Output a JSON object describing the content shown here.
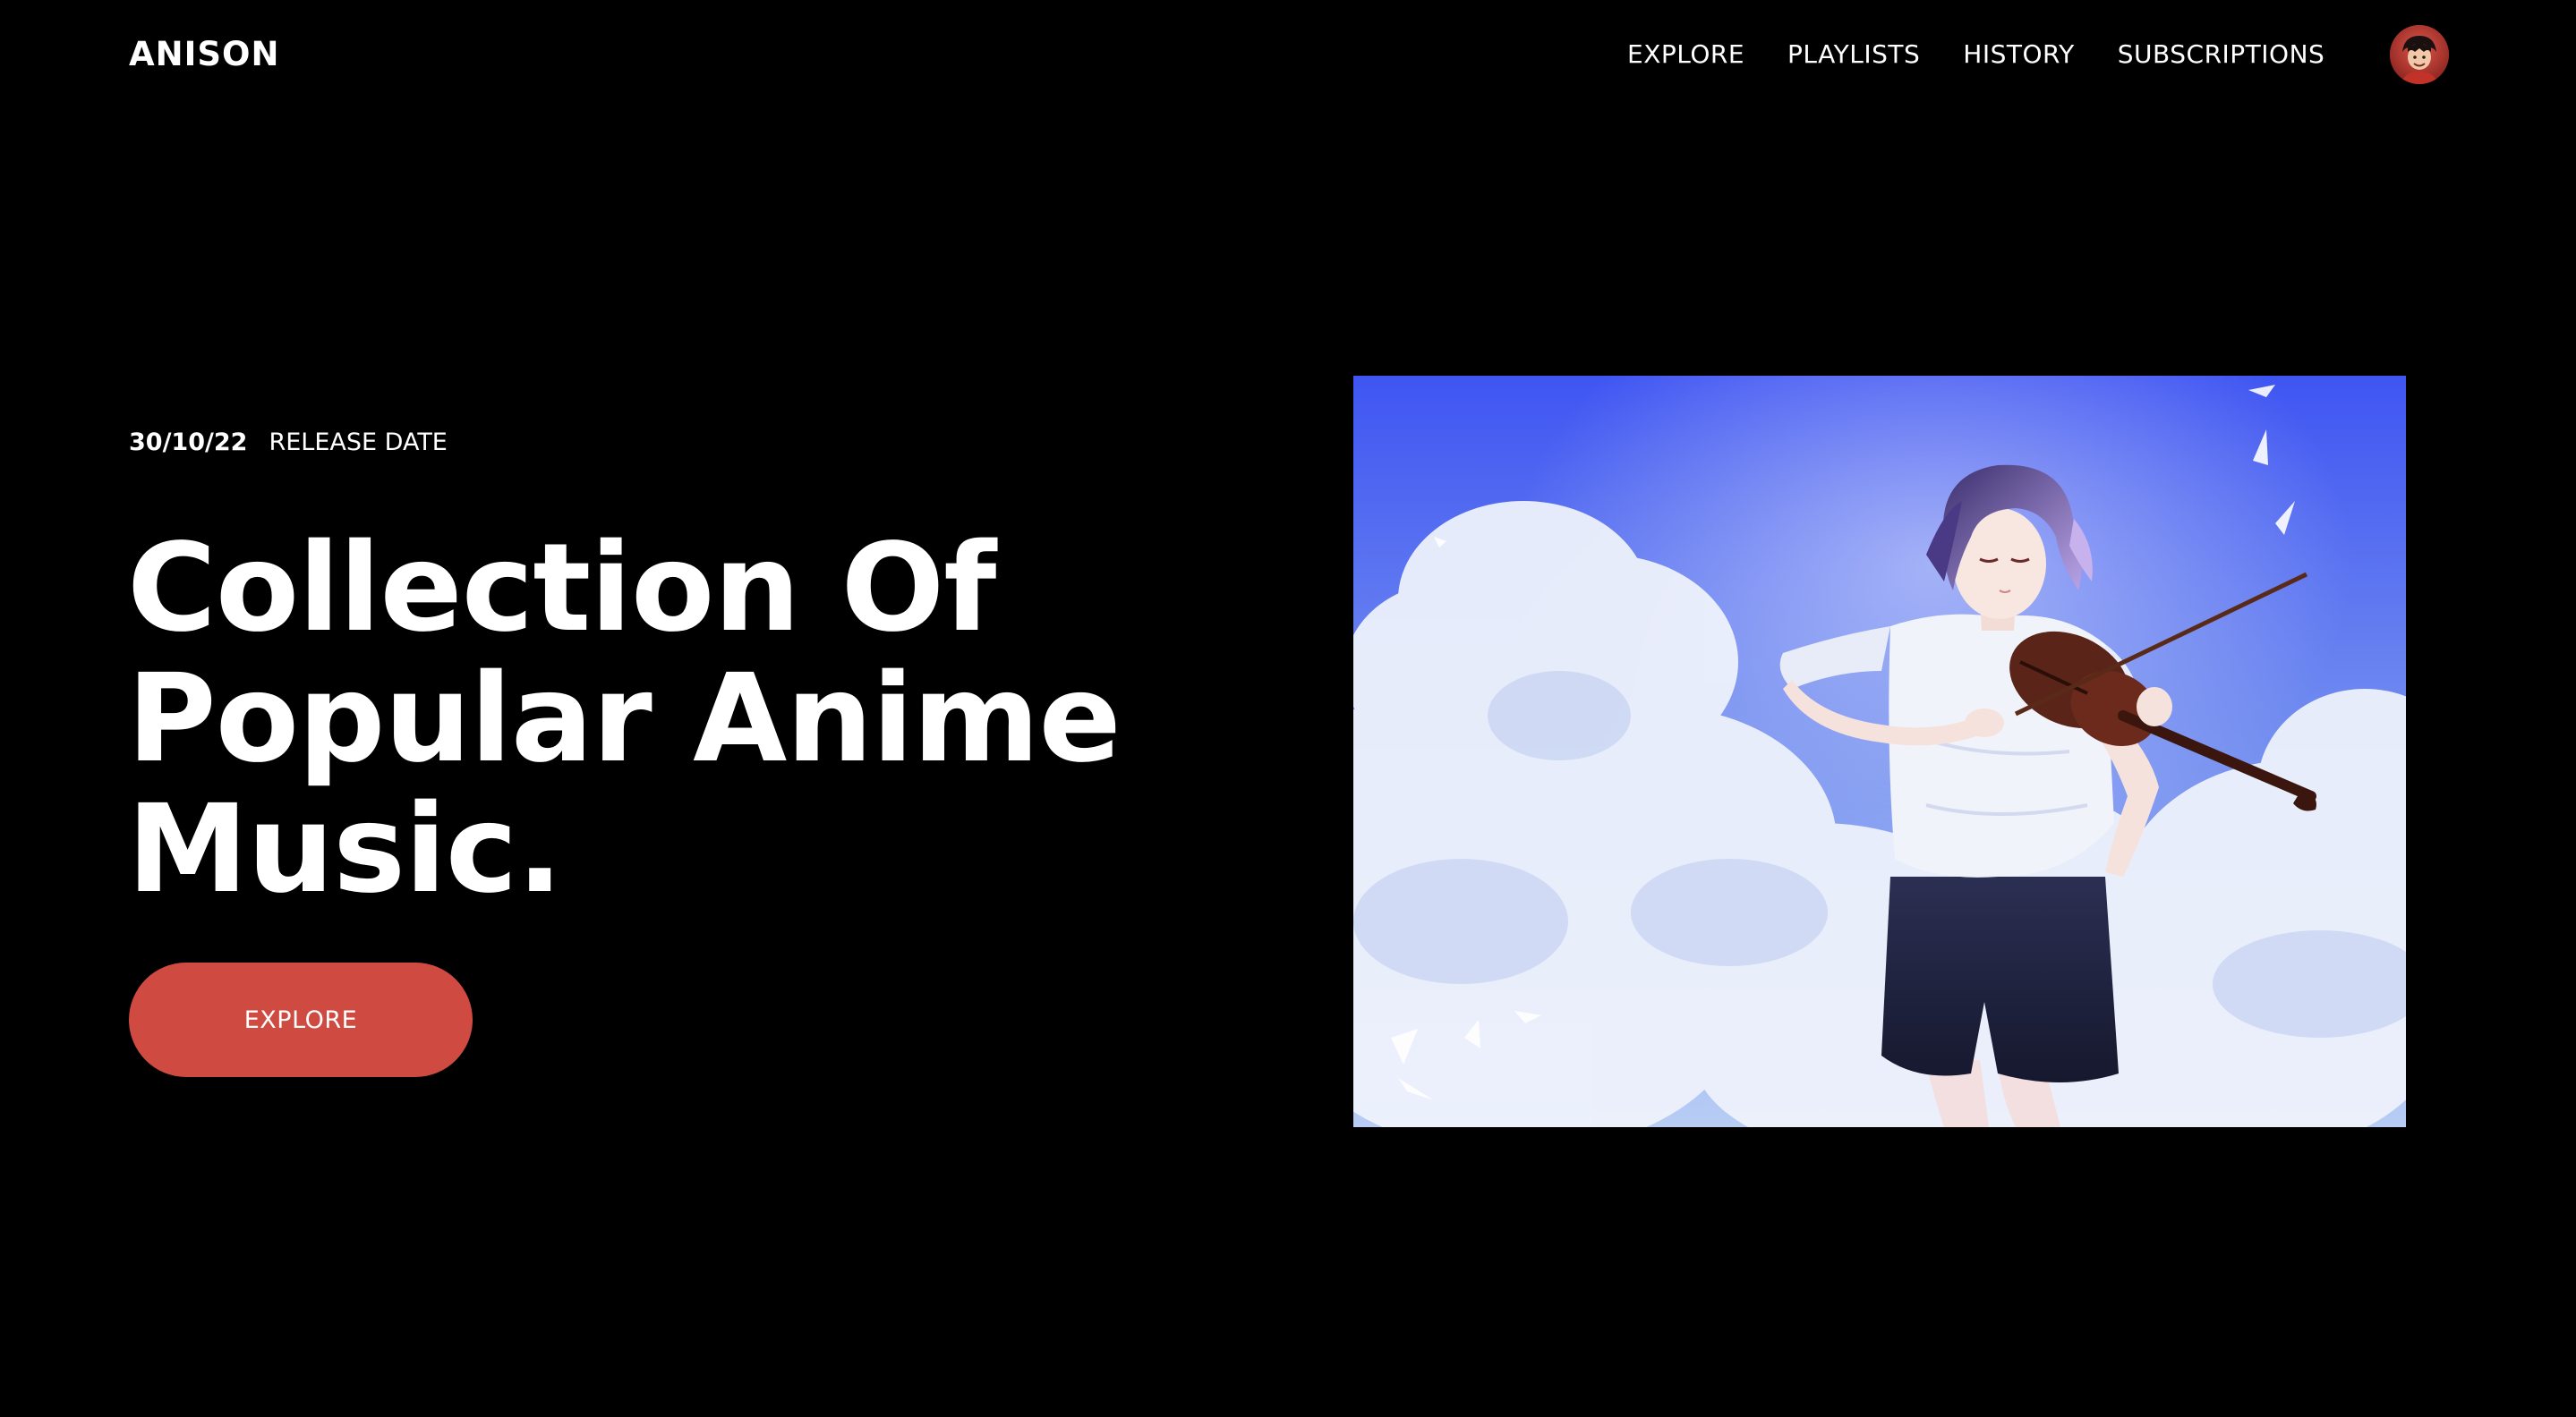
{
  "header": {
    "logo": "ANISON",
    "nav": [
      {
        "label": "EXPLORE"
      },
      {
        "label": "PLAYLISTS"
      },
      {
        "label": "HISTORY"
      },
      {
        "label": "SUBSCRIPTIONS"
      }
    ],
    "avatar_icon": "user-avatar"
  },
  "hero": {
    "release_date": "30/10/22",
    "release_label": "RELEASE DATE",
    "title_lines": [
      "Collection Of",
      "Popular Anime",
      "Music."
    ],
    "cta_label": "EXPLORE"
  },
  "artwork": {
    "description_icon": "anime-violinist-illustration"
  },
  "colors": {
    "background": "#000000",
    "text": "#ffffff",
    "accent": "#cf4a40",
    "sky": "#4459f0"
  }
}
